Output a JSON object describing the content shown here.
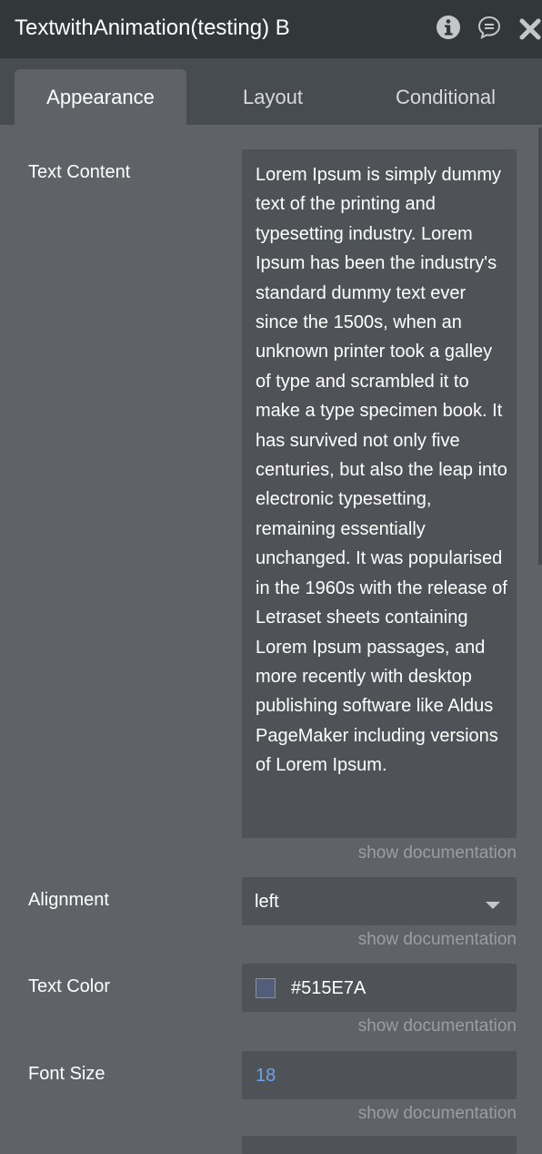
{
  "header": {
    "title": "TextwithAnimation(testing) B",
    "icons": [
      "info-icon",
      "comment-icon",
      "close-icon"
    ]
  },
  "tabs": [
    {
      "label": "Appearance",
      "active": true
    },
    {
      "label": "Layout",
      "active": false
    },
    {
      "label": "Conditional",
      "active": false
    }
  ],
  "fields": {
    "text_content": {
      "label": "Text Content",
      "value": "Lorem Ipsum is simply dummy text of the printing and typesetting industry. Lorem Ipsum has been the industry's standard dummy text ever since the 1500s, when an unknown printer took a galley of type and scrambled it to make a type specimen book. It has survived not only five centuries, but also the leap into electronic typesetting, remaining essentially unchanged. It was popularised in the 1960s with the release of Letraset sheets containing Lorem Ipsum passages, and more recently with desktop publishing software like Aldus PageMaker including versions of Lorem Ipsum.",
      "doc": "show documentation"
    },
    "alignment": {
      "label": "Alignment",
      "value": "left",
      "doc": "show documentation"
    },
    "text_color": {
      "label": "Text Color",
      "value": "#515E7A",
      "swatch": "#515E7A",
      "doc": "show documentation"
    },
    "font_size": {
      "label": "Font Size",
      "value": "18",
      "doc": "show documentation"
    }
  },
  "colors": {
    "panel_bg": "#5f6368",
    "header_bg": "#32373a",
    "tabbar_bg": "#474c50",
    "field_bg": "#4f5357",
    "link_muted": "#9a9ea3",
    "number_accent": "#6fa3e8"
  }
}
